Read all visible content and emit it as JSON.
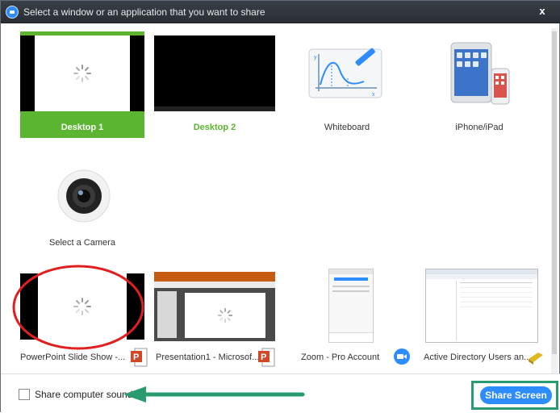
{
  "window": {
    "title": "Select a window or an application that you want to share",
    "close_glyph": "x"
  },
  "tiles": {
    "desktop1": "Desktop 1",
    "desktop2": "Desktop 2",
    "whiteboard": "Whiteboard",
    "iphone": "iPhone/iPad",
    "camera": "Select a Camera",
    "powerpoint": "PowerPoint Slide Show -...",
    "presentation": "Presentation1 - Microsof...",
    "zoom": "Zoom - Pro Account",
    "ad": "Active Directory Users an..."
  },
  "footer": {
    "sound_label": "Share computer sound",
    "share_button": "Share Screen"
  },
  "colors": {
    "selected": "#5cb531",
    "accent": "#2d8cff",
    "annotation_red": "#e02020",
    "annotation_green": "#2a9b6f"
  },
  "icons": [
    "zoom-app-icon",
    "close-icon",
    "spinner-icon",
    "whiteboard-icon",
    "ipad-icon",
    "camera-icon",
    "powerpoint-icon",
    "zoom-icon",
    "folder-icon"
  ]
}
